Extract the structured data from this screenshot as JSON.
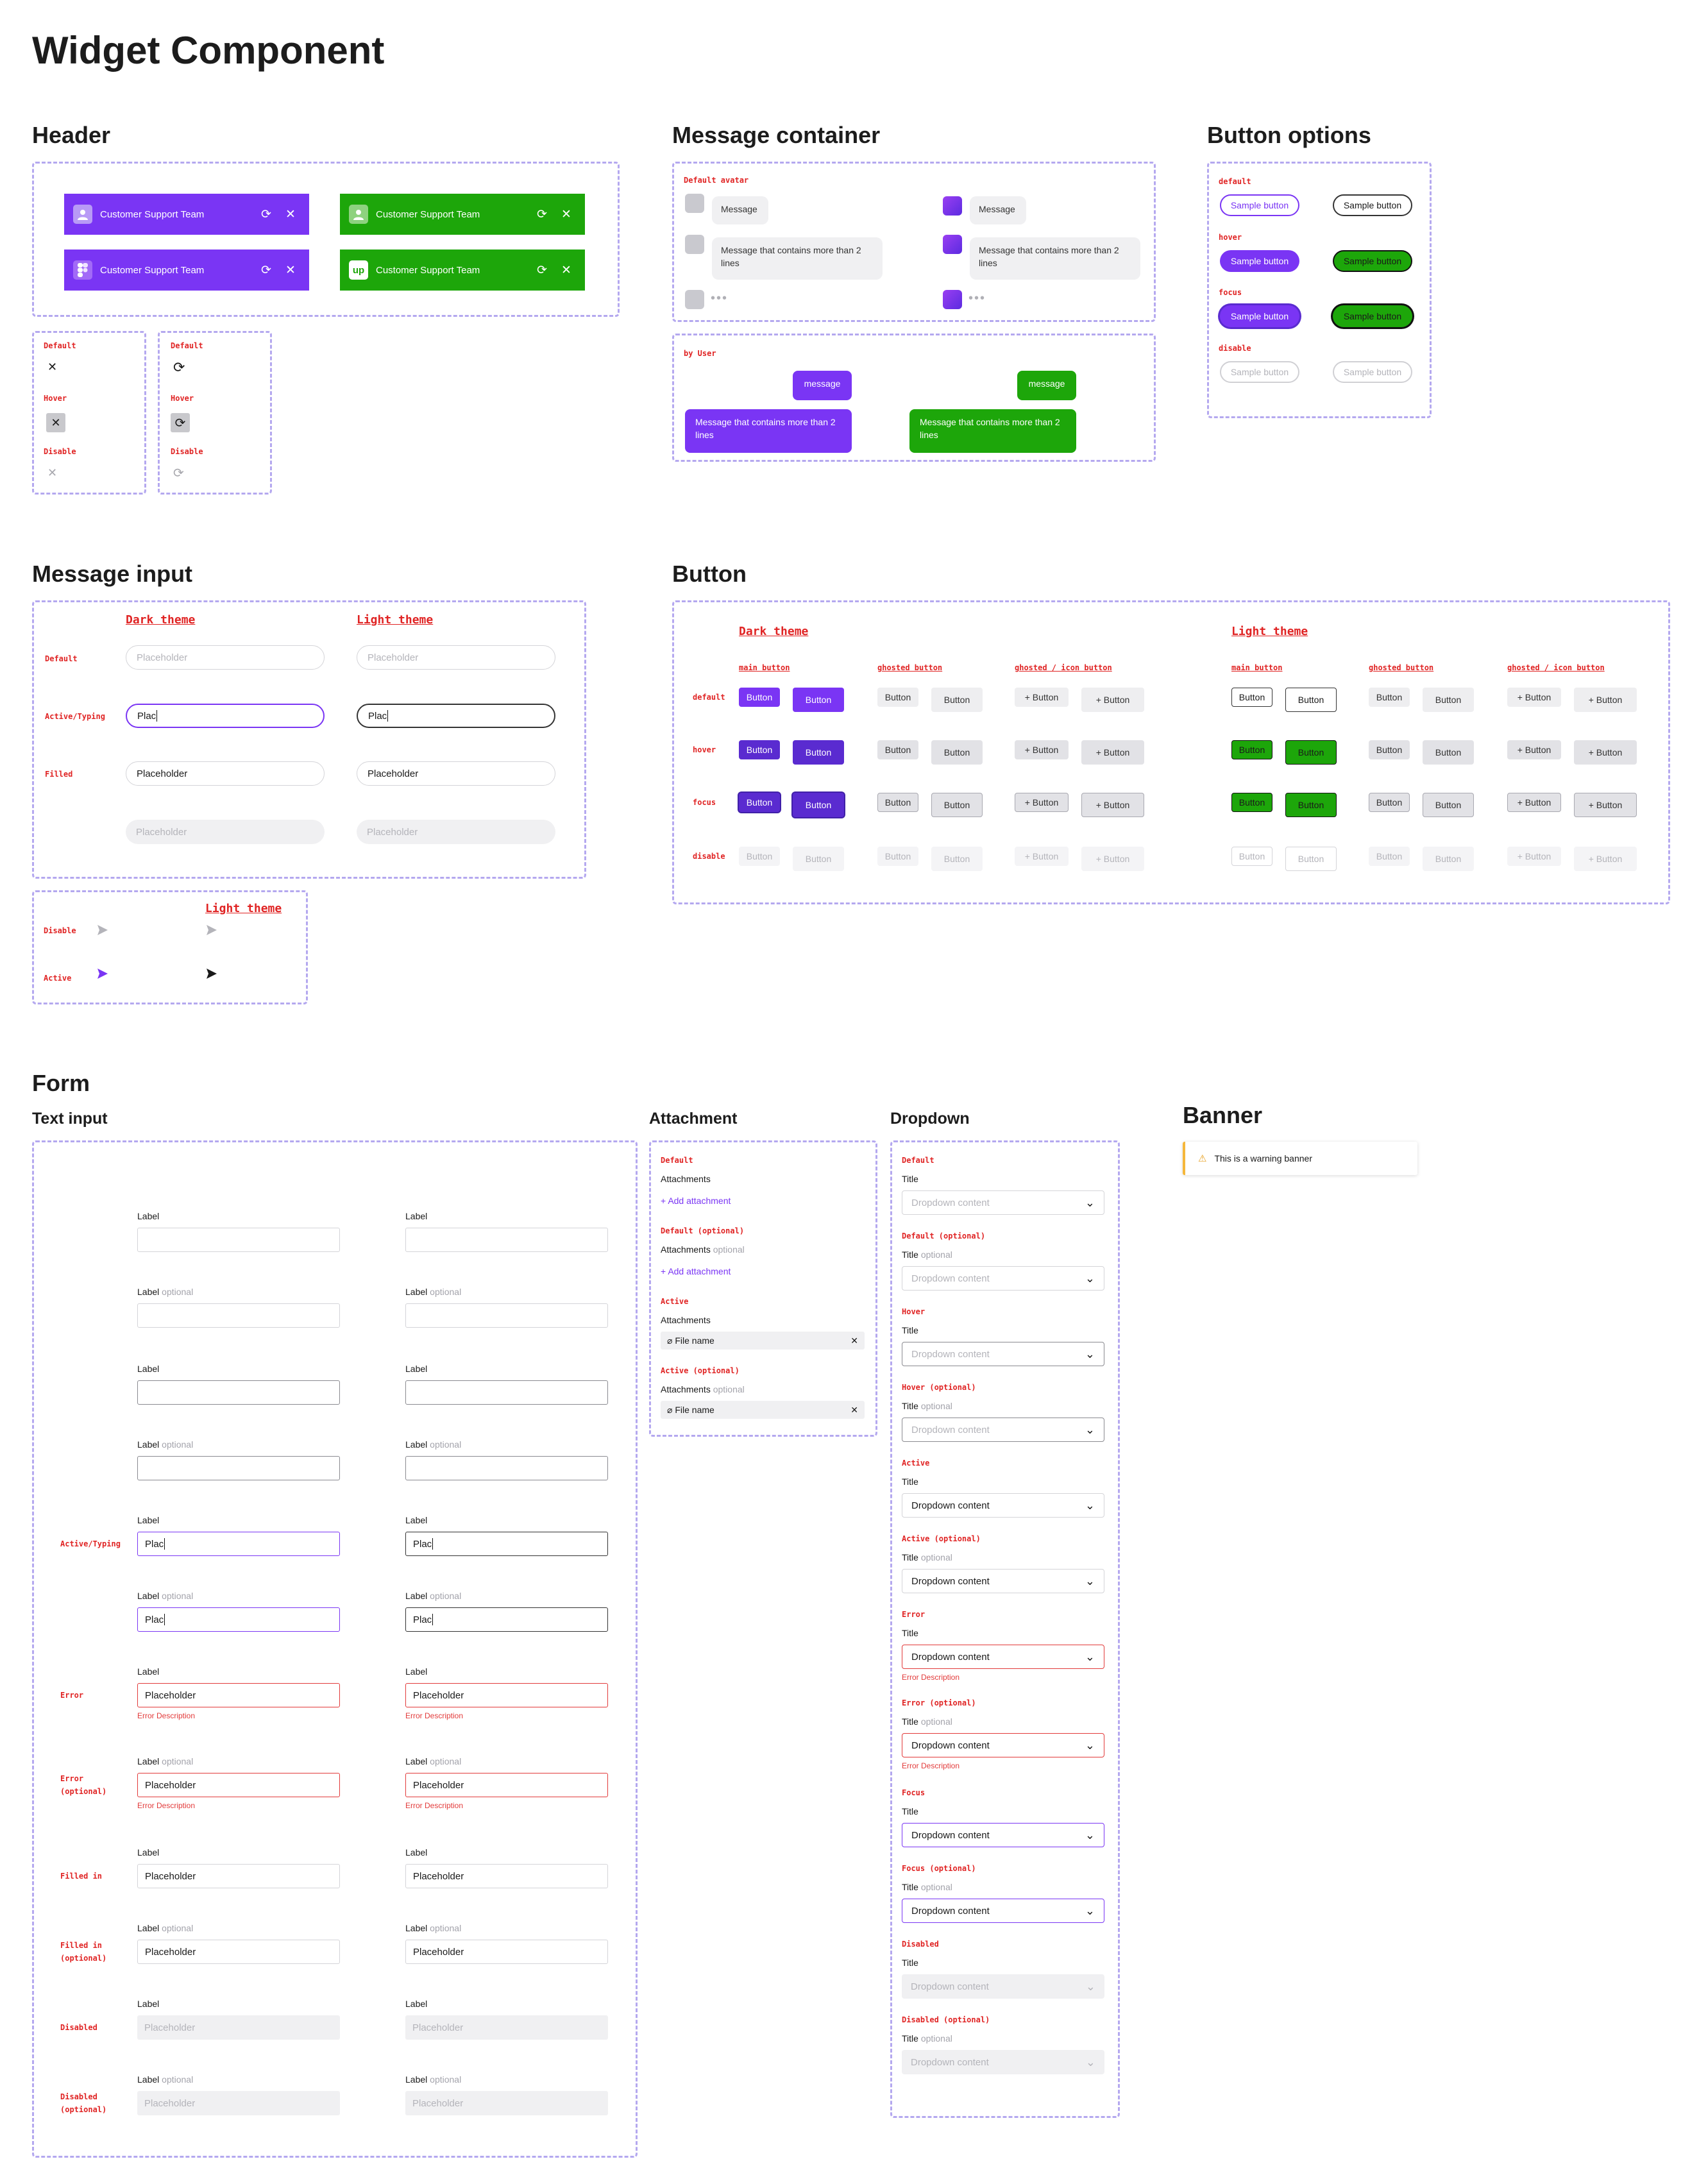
{
  "page_title": "Widget Component",
  "colors": {
    "purple": "#7a35f4",
    "purple_dark": "#5a2bd0",
    "green": "#1da60a",
    "green_dark": "#168a07",
    "red": "#e02424",
    "dash": "#b4a8ef",
    "gray_bg": "#f0f0f2"
  },
  "header": {
    "title": "Header",
    "bars": [
      {
        "text": "Customer Support Team",
        "avatar": "user-avatar-icon"
      },
      {
        "text": "Customer Support Team",
        "avatar": "user-avatar-icon"
      },
      {
        "text": "Customer Support Team",
        "avatar": "figma-logo-icon"
      },
      {
        "text": "Customer Support Team",
        "avatar": "up-logo",
        "logo_text": "up"
      }
    ],
    "close_states": {
      "default": "Default",
      "hover": "Hover",
      "disable": "Disable"
    },
    "refresh_states": {
      "default": "Default",
      "hover": "Hover",
      "disable": "Disable"
    }
  },
  "message_container": {
    "title": "Message container",
    "default_avatar_label": "Default avatar",
    "short_message": "Message",
    "long_message": "Message that contains more than 2 lines",
    "by_user_label": "by User",
    "user_short": "message",
    "user_long": "Message that contains more than 2 lines"
  },
  "button_options": {
    "title": "Button options",
    "states": {
      "default": "default",
      "hover": "hover",
      "focus": "focus",
      "disable": "disable"
    },
    "label": "Sample button"
  },
  "message_input": {
    "title": "Message input",
    "dark_theme": "Dark theme",
    "light_theme": "Light theme",
    "states": {
      "default": "Default",
      "active": "Active/Typing",
      "filled": "Filled"
    },
    "placeholder": "Placeholder",
    "typing_value": "Plac",
    "send": {
      "light_theme": "Light theme",
      "disable": "Disable",
      "active": "Active"
    }
  },
  "button": {
    "title": "Button",
    "dark_theme": "Dark theme",
    "light_theme": "Light theme",
    "columns": {
      "main": "main button",
      "ghosted": "ghosted button",
      "ghosted_icon": "ghosted / icon button"
    },
    "rows": {
      "default": "default",
      "hover": "hover",
      "focus": "focus",
      "disable": "disable"
    },
    "label": "Button",
    "icon_label": "+ Button"
  },
  "form": {
    "title": "Form",
    "text_input_title": "Text input",
    "label": "Label",
    "optional": "optional",
    "value": "Plac",
    "placeholder": "Placeholder",
    "error_desc": "Error Description",
    "states": {
      "active": "Active/Typing",
      "error": "Error",
      "error_opt_1": "Error",
      "error_opt_2": "(optional)",
      "filled": "Filled in",
      "filled_opt_1": "Filled in",
      "filled_opt_2": "(optional)",
      "disabled": "Disabled",
      "disabled_opt_1": "Disabled",
      "disabled_opt_2": "(optional)"
    }
  },
  "attachment": {
    "title": "Attachment",
    "states": {
      "default": "Default",
      "default_opt": "Default (optional)",
      "active": "Active",
      "active_opt": "Active (optional)"
    },
    "label": "Attachments",
    "optional": "optional",
    "add": "Add attachment",
    "file": "File name"
  },
  "dropdown": {
    "title": "Dropdown",
    "field_title": "Title",
    "optional": "optional",
    "content": "Dropdown content",
    "error_desc": "Error Description",
    "states": {
      "default": "Default",
      "default_opt": "Default (optional)",
      "hover": "Hover",
      "hover_opt": "Hover (optional)",
      "active": "Active",
      "active_opt": "Active (optional)",
      "error": "Error",
      "error_opt": "Error (optional)",
      "focus": "Focus",
      "focus_opt": "Focus (optional)",
      "disabled": "Disabled",
      "disabled_opt": "Disabled (optional)"
    }
  },
  "banner": {
    "title": "Banner",
    "text": "This is a warning banner",
    "icon": "warning-icon"
  }
}
